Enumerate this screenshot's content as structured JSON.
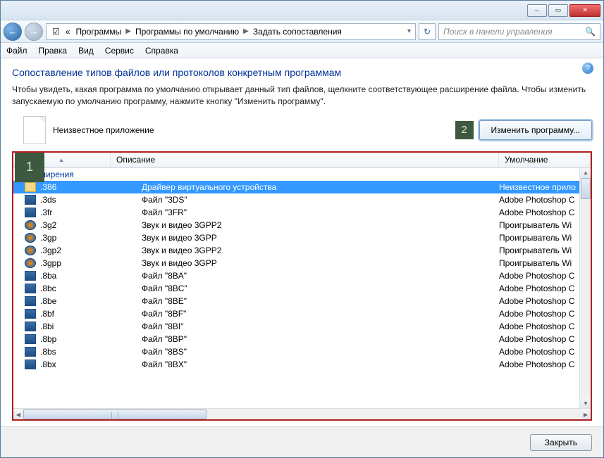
{
  "breadcrumb": {
    "prefix": "«",
    "items": [
      "Программы",
      "Программы по умолчанию",
      "Задать сопоставления"
    ]
  },
  "search": {
    "placeholder": "Поиск в панели управления"
  },
  "menu": {
    "file": "Файл",
    "edit": "Правка",
    "view": "Вид",
    "service": "Сервис",
    "help": "Справка"
  },
  "heading": "Сопоставление типов файлов или протоколов конкретным программам",
  "subtext": "Чтобы увидеть, какая программа по умолчанию открывает данный тип файлов, щелкните соответствующее расширение файла. Чтобы изменить запускаемую по умолчанию программу, нажмите кнопку \"Изменить программу\".",
  "appname": "Неизвестное приложение",
  "change_button": "Изменить программу...",
  "callouts": {
    "one": "1",
    "two": "2"
  },
  "columns": {
    "name": "",
    "desc": "Описание",
    "def": "Умолчание"
  },
  "group_header": "Расширения",
  "rows": [
    {
      "icon": "folder",
      "ext": ".386",
      "desc": "Драйвер виртуального устройства",
      "def": "Неизвестное прило",
      "selected": true
    },
    {
      "icon": "ps",
      "ext": ".3ds",
      "desc": "Файл \"3DS\"",
      "def": "Adobe Photoshop C"
    },
    {
      "icon": "ps",
      "ext": ".3fr",
      "desc": "Файл \"3FR\"",
      "def": "Adobe Photoshop C"
    },
    {
      "icon": "wmp",
      "ext": ".3g2",
      "desc": "Звук и видео 3GPP2",
      "def": "Проигрыватель Wi"
    },
    {
      "icon": "wmp",
      "ext": ".3gp",
      "desc": "Звук и видео 3GPP",
      "def": "Проигрыватель Wi"
    },
    {
      "icon": "wmp",
      "ext": ".3gp2",
      "desc": "Звук и видео 3GPP2",
      "def": "Проигрыватель Wi"
    },
    {
      "icon": "wmp",
      "ext": ".3gpp",
      "desc": "Звук и видео 3GPP",
      "def": "Проигрыватель Wi"
    },
    {
      "icon": "ps",
      "ext": ".8ba",
      "desc": "Файл \"8BA\"",
      "def": "Adobe Photoshop C"
    },
    {
      "icon": "ps",
      "ext": ".8bc",
      "desc": "Файл \"8BC\"",
      "def": "Adobe Photoshop C"
    },
    {
      "icon": "ps",
      "ext": ".8be",
      "desc": "Файл \"8BE\"",
      "def": "Adobe Photoshop C"
    },
    {
      "icon": "ps",
      "ext": ".8bf",
      "desc": "Файл \"8BF\"",
      "def": "Adobe Photoshop C"
    },
    {
      "icon": "ps",
      "ext": ".8bi",
      "desc": "Файл \"8BI\"",
      "def": "Adobe Photoshop C"
    },
    {
      "icon": "ps",
      "ext": ".8bp",
      "desc": "Файл \"8BP\"",
      "def": "Adobe Photoshop C"
    },
    {
      "icon": "ps",
      "ext": ".8bs",
      "desc": "Файл \"8BS\"",
      "def": "Adobe Photoshop C"
    },
    {
      "icon": "ps",
      "ext": ".8bx",
      "desc": "Файл \"8BX\"",
      "def": "Adobe Photoshop C"
    }
  ],
  "close_button": "Закрыть"
}
